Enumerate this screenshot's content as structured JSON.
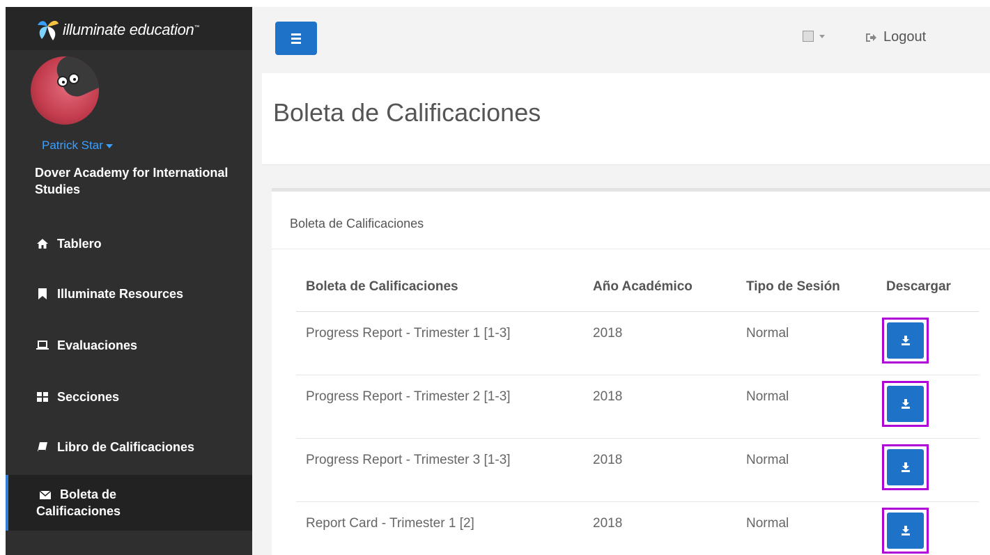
{
  "brand": {
    "name": "illuminate education",
    "tm": "™"
  },
  "user": {
    "name": "Patrick Star"
  },
  "school": {
    "name": "Dover Academy for International Studies"
  },
  "sidebar": {
    "items": [
      {
        "label": "Tablero",
        "icon": "home-icon"
      },
      {
        "label": "Illuminate Resources",
        "icon": "bookmark-icon"
      },
      {
        "label": "Evaluaciones",
        "icon": "laptop-icon"
      },
      {
        "label": "Secciones",
        "icon": "grid-icon"
      },
      {
        "label": "Libro de Calificaciones",
        "icon": "book-icon"
      },
      {
        "label_line1": "Boleta de",
        "label_line2": "Calificaciones",
        "icon": "envelope-icon",
        "active": true
      }
    ]
  },
  "topbar": {
    "logout_label": "Logout"
  },
  "page": {
    "title": "Boleta de Calificaciones"
  },
  "panel": {
    "heading": "Boleta de Calificaciones",
    "columns": [
      "Boleta de Calificaciones",
      "Año Académico",
      "Tipo de Sesión",
      "Descargar"
    ],
    "rows": [
      {
        "name": "Progress Report - Trimester 1 [1-3]",
        "year": "2018",
        "session": "Normal"
      },
      {
        "name": "Progress Report - Trimester 2 [1-3]",
        "year": "2018",
        "session": "Normal"
      },
      {
        "name": "Progress Report - Trimester 3 [1-3]",
        "year": "2018",
        "session": "Normal"
      },
      {
        "name": "Report Card - Trimester 1 [2]",
        "year": "2018",
        "session": "Normal"
      }
    ]
  },
  "colors": {
    "sidebar_bg": "#2f2f2f",
    "accent": "#1e73c8",
    "highlight_outline": "#b000d8",
    "user_link": "#3aa0ff"
  }
}
